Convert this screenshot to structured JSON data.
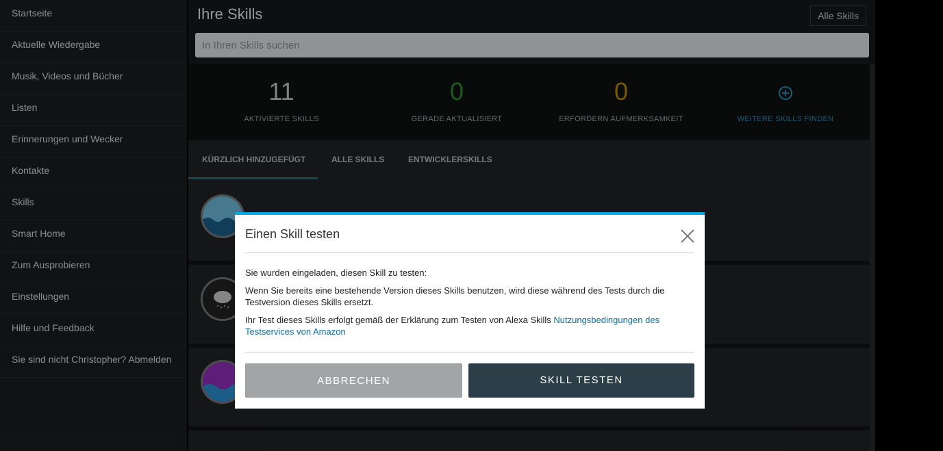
{
  "sidebar": {
    "items": [
      {
        "label": "Startseite"
      },
      {
        "label": "Aktuelle Wiedergabe"
      },
      {
        "label": "Musik, Videos und Bücher"
      },
      {
        "label": "Listen"
      },
      {
        "label": "Erinnerungen und Wecker"
      },
      {
        "label": "Kontakte"
      },
      {
        "label": "Skills"
      },
      {
        "label": "Smart Home"
      },
      {
        "label": "Zum Ausprobieren"
      },
      {
        "label": "Einstellungen"
      },
      {
        "label": "Hilfe und Feedback"
      },
      {
        "label": "Sie sind nicht Christopher? Abmelden"
      }
    ]
  },
  "header": {
    "title": "Ihre Skills",
    "filter_label": "Alle Skills",
    "search_placeholder": "In Ihren Skills suchen"
  },
  "stats": [
    {
      "value": "11",
      "label": "AKTIVIERTE SKILLS",
      "color": "#c4c7c9"
    },
    {
      "value": "0",
      "label": "GERADE AKTUALISIERT",
      "color": "#2e8b2e"
    },
    {
      "value": "0",
      "label": "ERFORDERN AUFMERKSAMKEIT",
      "color": "#b8860b"
    },
    {
      "value": "",
      "label": "WEITERE SKILLS FINDEN",
      "color": "#2a8ab8",
      "icon": "plus-circle-icon"
    }
  ],
  "tabs": [
    {
      "label": "KÜRZLICH HINZUGEFÜGT",
      "active": true
    },
    {
      "label": "ALLE SKILLS",
      "active": false
    },
    {
      "label": "ENTWICKLERSKILLS",
      "active": false
    }
  ],
  "dialog": {
    "title": "Einen Skill testen",
    "invite_text": "Sie wurden eingeladen, diesen Skill zu testen:",
    "replace_text": "Wenn Sie bereits eine bestehende Version dieses Skills benutzen, wird diese während des Tests durch die Testversion dieses Skills ersetzt.",
    "terms_text": "Ihr Test dieses Skills erfolgt gemäß der Erklärung zum Testen von Alexa Skills ",
    "terms_link": "Nutzungsbedingungen des Testservices von Amazon",
    "cancel_label": "ABBRECHEN",
    "confirm_label": "SKILL TESTEN",
    "accent_color": "#00a8e1"
  }
}
